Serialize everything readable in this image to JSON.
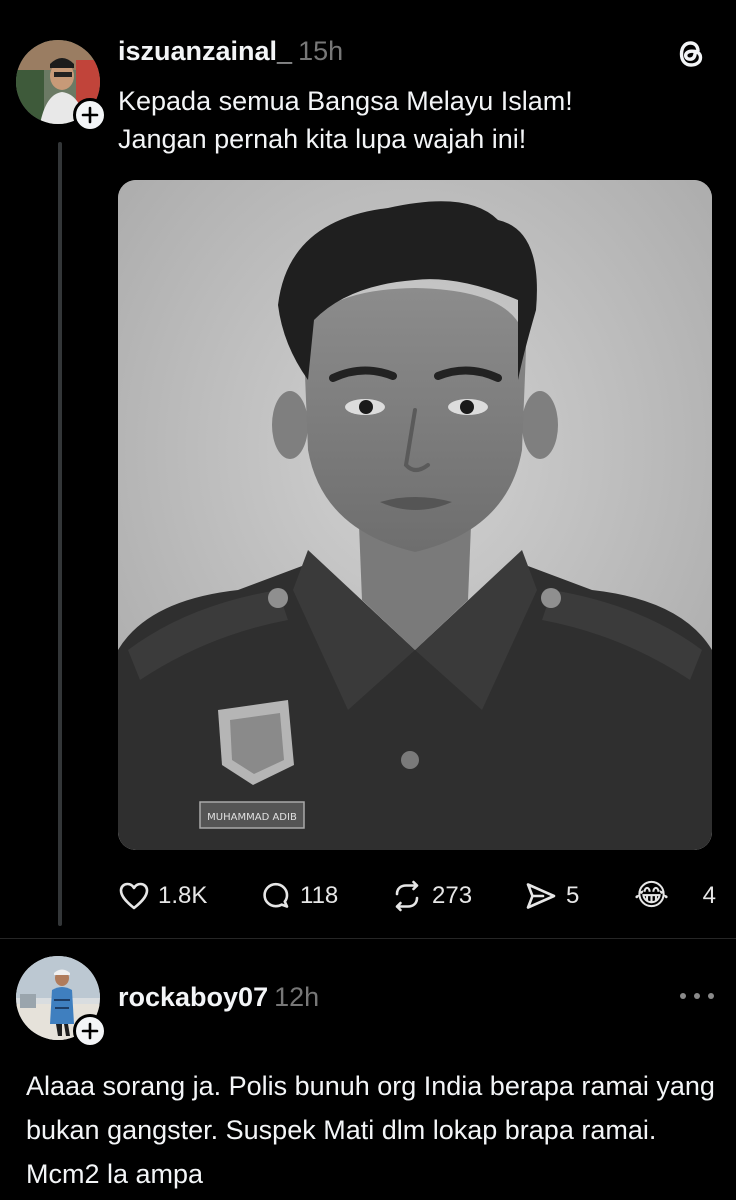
{
  "post": {
    "username": "iszuanzainal_",
    "time": "15h",
    "line1": "Kepada semua Bangsa Melayu Islam!",
    "line2": "Jangan pernah kita lupa wajah ini!",
    "image_alt": "Black and white portrait of a young man in uniform",
    "uniform_nametag": "MUHAMMAD ADIB",
    "stats": {
      "likes": "1.8K",
      "replies": "118",
      "reposts": "273",
      "shares": "5",
      "reaction_count": "4"
    },
    "reaction_emoji": "😂"
  },
  "reply": {
    "username": "rockaboy07",
    "time": "12h",
    "text": "Alaaa sorang ja. Polis bunuh org India berapa ramai yang bukan gangster. Suspek Mati dlm lokap brapa ramai. Mcm2 la ampa"
  },
  "icons": {
    "app_logo": "threads-logo-icon",
    "like": "heart-icon",
    "reply": "comment-bubble-icon",
    "repost": "repost-icon",
    "share": "send-icon",
    "more": "more-options-icon"
  },
  "colors": {
    "background": "#000000",
    "text": "#f3f5f7",
    "muted": "#777777",
    "thread_line": "#333638"
  }
}
